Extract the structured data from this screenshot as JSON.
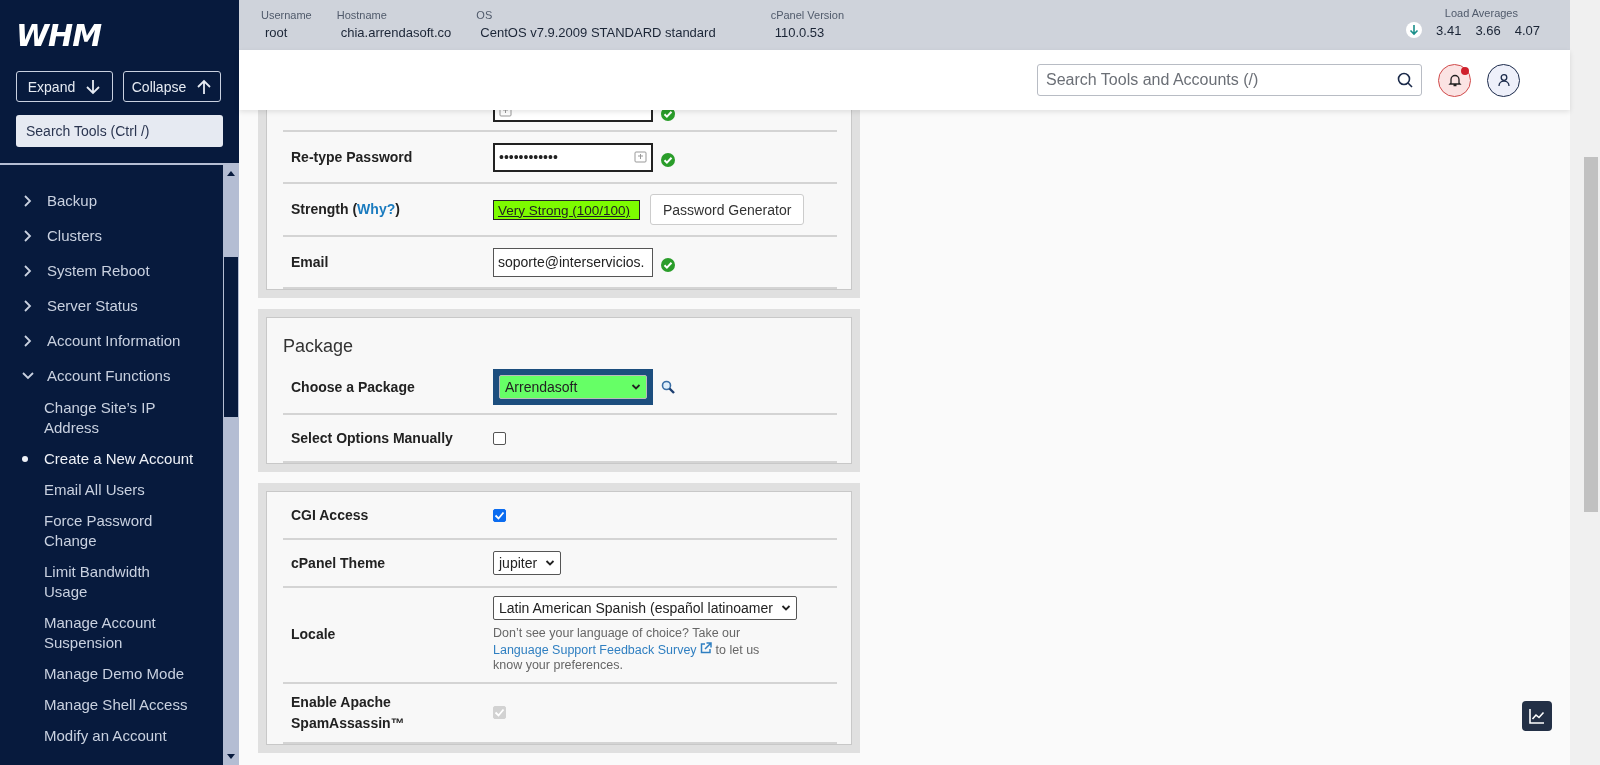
{
  "sidebar": {
    "logo": "WHM",
    "buttons": [
      {
        "label": "Expand",
        "kind": "expand"
      },
      {
        "label": "Collapse",
        "kind": "collapse"
      }
    ],
    "search": {
      "placeholder": "Search Tools (Ctrl /)"
    },
    "items": [
      {
        "label": "Backup",
        "expanded": false
      },
      {
        "label": "Clusters",
        "expanded": false
      },
      {
        "label": "System Reboot",
        "expanded": false
      },
      {
        "label": "Server Status",
        "expanded": false
      },
      {
        "label": "Account Information",
        "expanded": false
      },
      {
        "label": "Account Functions",
        "expanded": true,
        "children": [
          {
            "label": "Change Site’s IP Address",
            "selected": false
          },
          {
            "label": "Create a New Account",
            "selected": true
          },
          {
            "label": "Email All Users",
            "selected": false
          },
          {
            "label": "Force Password Change",
            "selected": false
          },
          {
            "label": "Limit Bandwidth Usage",
            "selected": false
          },
          {
            "label": "Manage Account Suspension",
            "selected": false
          },
          {
            "label": "Manage Demo Mode",
            "selected": false
          },
          {
            "label": "Manage Shell Access",
            "selected": false
          },
          {
            "label": "Modify an Account",
            "selected": false
          }
        ]
      }
    ]
  },
  "header": {
    "info": [
      {
        "label": "Username",
        "value": "root"
      },
      {
        "label": "Hostname",
        "value": "chia.arrendasoft.co"
      },
      {
        "label": "OS",
        "value": "CentOS v7.9.2009 STANDARD standard"
      },
      {
        "label": "cPanel Version",
        "value": "110.0.53"
      }
    ],
    "load_averages": {
      "label": "Load Averages",
      "values": [
        "3.41",
        "3.66",
        "4.07"
      ]
    }
  },
  "toolbar": {
    "search": {
      "placeholder": "Search Tools and Accounts (/)"
    },
    "notifications_unread": true
  },
  "sections": [
    {
      "rows": [
        {
          "kind": "password",
          "value": "",
          "valid": true
        },
        {
          "kind": "password",
          "label": "Re-type Password",
          "value": "••••••••••••",
          "valid": true
        },
        {
          "kind": "strength",
          "label_before": "Strength (",
          "link": "Why?",
          "label_after": ")",
          "meter": "Very Strong (100/100)",
          "level": 1,
          "button": "Password Generator"
        },
        {
          "kind": "email",
          "label": "Email",
          "value": "soporte@interservicios.",
          "valid": true
        }
      ]
    },
    {
      "title": "Package",
      "rows": [
        {
          "kind": "select",
          "label": "Choose a Package",
          "value": "Arrendasoft",
          "highlighted": true,
          "lookup": true
        },
        {
          "kind": "checkbox",
          "label": "Select Options Manually",
          "checked": false,
          "disabled": false
        }
      ]
    },
    {
      "rows": [
        {
          "kind": "checkbox",
          "label": "CGI Access",
          "checked": true,
          "disabled": false
        },
        {
          "kind": "select",
          "label": "cPanel Theme",
          "value": "jupiter",
          "highlighted": false
        },
        {
          "kind": "select",
          "label": "Locale",
          "value": "Latin American Spanish (español latinoamer",
          "highlighted": false,
          "help": {
            "before": "Don’t see your language of choice? Take our",
            "link": "Language Support Feedback Survey",
            "after": "to let us know your preferences."
          }
        },
        {
          "kind": "checkbox",
          "label": "Enable Apache SpamAssassin™",
          "checked": true,
          "disabled": true
        }
      ]
    }
  ]
}
